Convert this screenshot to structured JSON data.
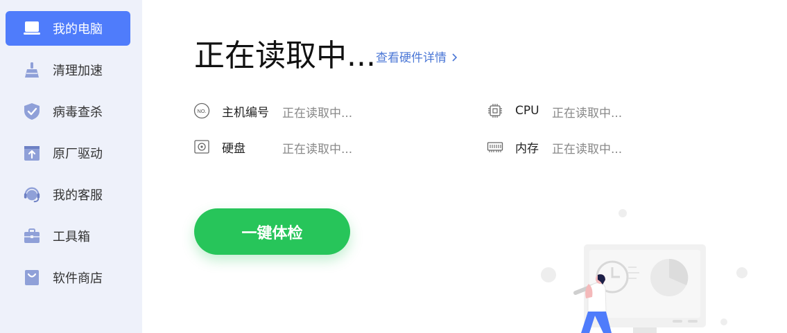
{
  "sidebar": {
    "items": [
      {
        "label": "我的电脑",
        "icon": "laptop-icon",
        "active": true
      },
      {
        "label": "清理加速",
        "icon": "broom-icon",
        "active": false
      },
      {
        "label": "病毒查杀",
        "icon": "shield-icon",
        "active": false
      },
      {
        "label": "原厂驱动",
        "icon": "driver-upload-icon",
        "active": false
      },
      {
        "label": "我的客服",
        "icon": "headset-icon",
        "active": false
      },
      {
        "label": "工具箱",
        "icon": "toolbox-icon",
        "active": false
      },
      {
        "label": "软件商店",
        "icon": "shopping-bag-icon",
        "active": false
      }
    ]
  },
  "main": {
    "title": "正在读取中...",
    "detail_link": "查看硬件详情",
    "info": {
      "serial": {
        "label": "主机编号",
        "value": "正在读取中...",
        "icon": "serial-number-icon"
      },
      "cpu": {
        "label": "CPU",
        "value": "正在读取中...",
        "icon": "cpu-chip-icon"
      },
      "disk": {
        "label": "硬盘",
        "value": "正在读取中...",
        "icon": "hard-disk-icon"
      },
      "memory": {
        "label": "内存",
        "value": "正在读取中...",
        "icon": "memory-module-icon"
      }
    },
    "check_button": "一键体检",
    "icon_text": "NO."
  },
  "colors": {
    "accent": "#4f7cfb",
    "sidebar_bg": "#eef1fa",
    "button_green": "#27c55a",
    "link_blue": "#4b77d6",
    "nav_icon": "#8fa0d8"
  }
}
